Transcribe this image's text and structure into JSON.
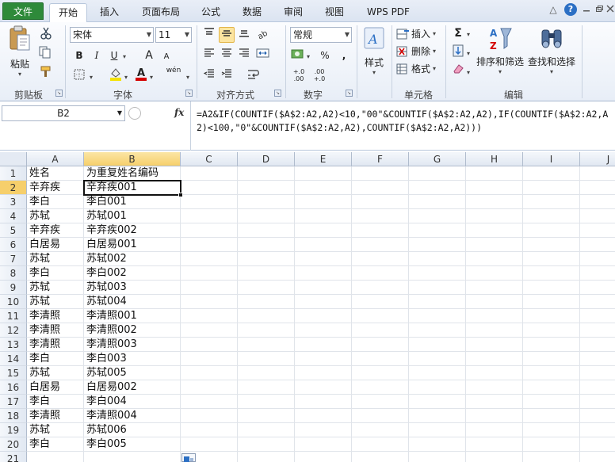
{
  "menu": {
    "tabs": [
      "文件",
      "开始",
      "插入",
      "页面布局",
      "公式",
      "数据",
      "审阅",
      "视图",
      "WPS PDF"
    ],
    "active_tab": "开始",
    "file_color": "#2e8a3a",
    "window_controls": [
      "up-triangle-icon",
      "help-icon",
      "minimize-icon",
      "restore-icon",
      "close-icon"
    ],
    "help_glyph": "?"
  },
  "ribbon": {
    "clipboard": {
      "paste_label": "粘贴",
      "group_label": "剪贴板"
    },
    "font": {
      "font_name": "宋体",
      "font_size": "11",
      "bold": "B",
      "italic": "I",
      "underline": "U",
      "grow": "A",
      "shrink": "A",
      "wen": "wén",
      "group_label": "字体",
      "fill_color": "#f5e200",
      "font_color": "#d40000"
    },
    "alignment": {
      "group_label": "对齐方式"
    },
    "number": {
      "format": "常规",
      "percent": "%",
      "comma": ",",
      "inc_decimal": "+.0 .00",
      "dec_decimal": ".00 +.0",
      "group_label": "数字"
    },
    "styles": {
      "label": "样式"
    },
    "cells": {
      "insert": "插入",
      "delete": "删除",
      "format": "格式",
      "group_label": "单元格"
    },
    "editing": {
      "sum": "Σ",
      "sort_filter": "排序和筛选",
      "find_select": "查找和选择",
      "group_label": "编辑"
    }
  },
  "formula_bar": {
    "name_box": "B2",
    "fx": "fx",
    "formula": "=A2&IF(COUNTIF($A$2:A2,A2)<10,\"00\"&COUNTIF($A$2:A2,A2),IF(COUNTIF($A$2:A2,A2)<100,\"0\"&COUNTIF($A$2:A2,A2),COUNTIF($A$2:A2,A2)))"
  },
  "sheet": {
    "columns": [
      "A",
      "B",
      "C",
      "D",
      "E",
      "F",
      "G",
      "H",
      "I",
      "J"
    ],
    "selected_column": "B",
    "selected_row": 2,
    "selected_cell": "B2",
    "rows": [
      {
        "row": 1,
        "a": "姓名",
        "b": "为重复姓名编码"
      },
      {
        "row": 2,
        "a": "辛弃疾",
        "b": "辛弃疾001"
      },
      {
        "row": 3,
        "a": "李白",
        "b": "李白001"
      },
      {
        "row": 4,
        "a": "苏轼",
        "b": "苏轼001"
      },
      {
        "row": 5,
        "a": "辛弃疾",
        "b": "辛弃疾002"
      },
      {
        "row": 6,
        "a": "白居易",
        "b": "白居易001"
      },
      {
        "row": 7,
        "a": "苏轼",
        "b": "苏轼002"
      },
      {
        "row": 8,
        "a": "李白",
        "b": "李白002"
      },
      {
        "row": 9,
        "a": "苏轼",
        "b": "苏轼003"
      },
      {
        "row": 10,
        "a": "苏轼",
        "b": "苏轼004"
      },
      {
        "row": 11,
        "a": "李清照",
        "b": "李清照001"
      },
      {
        "row": 12,
        "a": "李清照",
        "b": "李清照002"
      },
      {
        "row": 13,
        "a": "李清照",
        "b": "李清照003"
      },
      {
        "row": 14,
        "a": "李白",
        "b": "李白003"
      },
      {
        "row": 15,
        "a": "苏轼",
        "b": "苏轼005"
      },
      {
        "row": 16,
        "a": "白居易",
        "b": "白居易002"
      },
      {
        "row": 17,
        "a": "李白",
        "b": "李白004"
      },
      {
        "row": 18,
        "a": "李清照",
        "b": "李清照004"
      },
      {
        "row": 19,
        "a": "苏轼",
        "b": "苏轼006"
      },
      {
        "row": 20,
        "a": "李白",
        "b": "李白005"
      },
      {
        "row": 21,
        "a": "",
        "b": ""
      }
    ]
  }
}
